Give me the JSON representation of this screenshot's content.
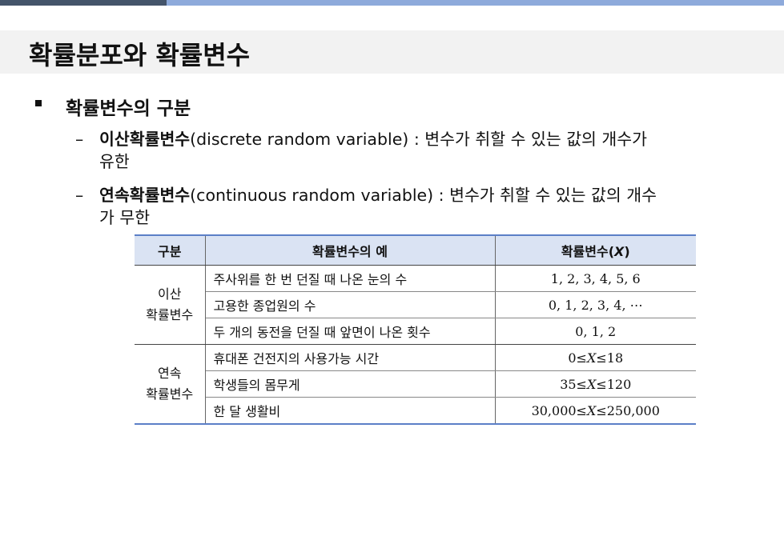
{
  "title": "확률분포와 확률변수",
  "section": {
    "heading": "확률변수의 구분",
    "items": [
      {
        "dash": "–",
        "term": "이산확률변수",
        "desc_line1": "(discrete random variable) : 변수가 취할 수 있는 값의 개수가",
        "desc_line2": "유한"
      },
      {
        "dash": "–",
        "term": "연속확률변수",
        "desc_line1": "(continuous random variable) : 변수가 취할 수 있는 값의 개수",
        "desc_line2": "가 무한"
      }
    ]
  },
  "table": {
    "headers": [
      "구분",
      "확률변수의 예",
      "확률변수(X)"
    ],
    "groups": [
      {
        "label_line1": "이산",
        "label_line2": "확률변수",
        "rows": [
          {
            "example": "주사위를 한 번 던질 때 나온 눈의 수",
            "value": "1, 2, 3, 4, 5, 6"
          },
          {
            "example": "고용한 종업원의 수",
            "value": "0, 1, 2, 3, 4, ⋯"
          },
          {
            "example": "두 개의 동전을 던질 때 앞면이 나온 횟수",
            "value": "0, 1, 2"
          }
        ]
      },
      {
        "label_line1": "연속",
        "label_line2": "확률변수",
        "rows": [
          {
            "example": "휴대폰 건전지의 사용가능 시간",
            "value": "0≤X≤18"
          },
          {
            "example": "학생들의 몸무게",
            "value": "35≤X≤120"
          },
          {
            "example": "한 달 생활비",
            "value": "30,000≤X≤250,000"
          }
        ]
      }
    ]
  },
  "colors": {
    "topbar_dark": "#44546a",
    "topbar_light": "#8eaadb",
    "title_band": "#f2f2f2",
    "table_header": "#dae3f3",
    "table_rule": "#5b7fc7"
  }
}
